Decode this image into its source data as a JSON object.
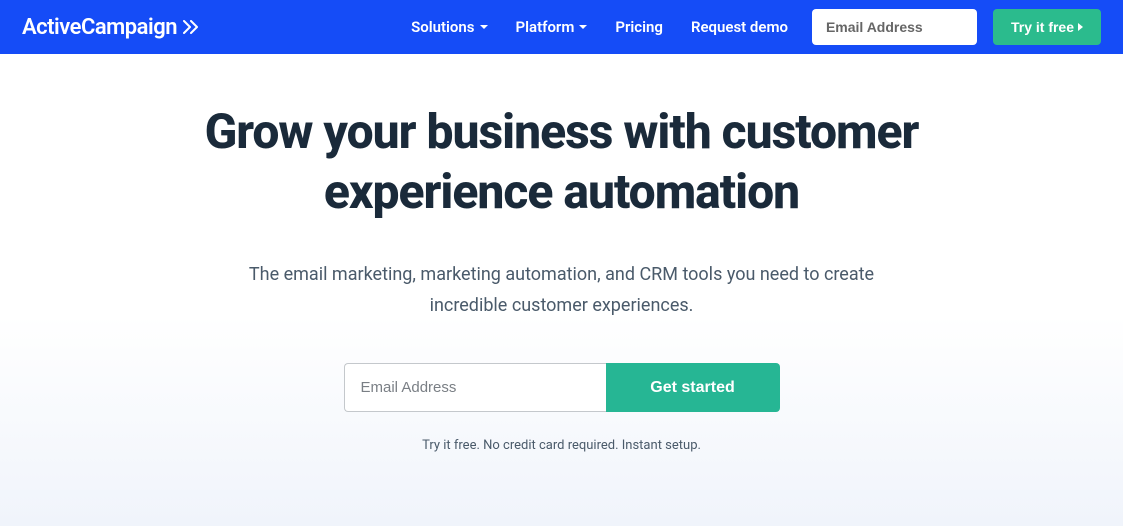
{
  "header": {
    "logo": "ActiveCampaign",
    "nav": {
      "solutions": "Solutions",
      "platform": "Platform",
      "pricing": "Pricing",
      "request_demo": "Request demo"
    },
    "email_placeholder": "Email Address",
    "cta": "Try it free"
  },
  "hero": {
    "title": "Grow your business with customer experience automation",
    "subtitle": "The email marketing, marketing automation, and CRM tools you need to create incredible customer experiences.",
    "email_placeholder": "Email Address",
    "cta": "Get started",
    "note": "Try it free. No credit card required. Instant setup."
  }
}
